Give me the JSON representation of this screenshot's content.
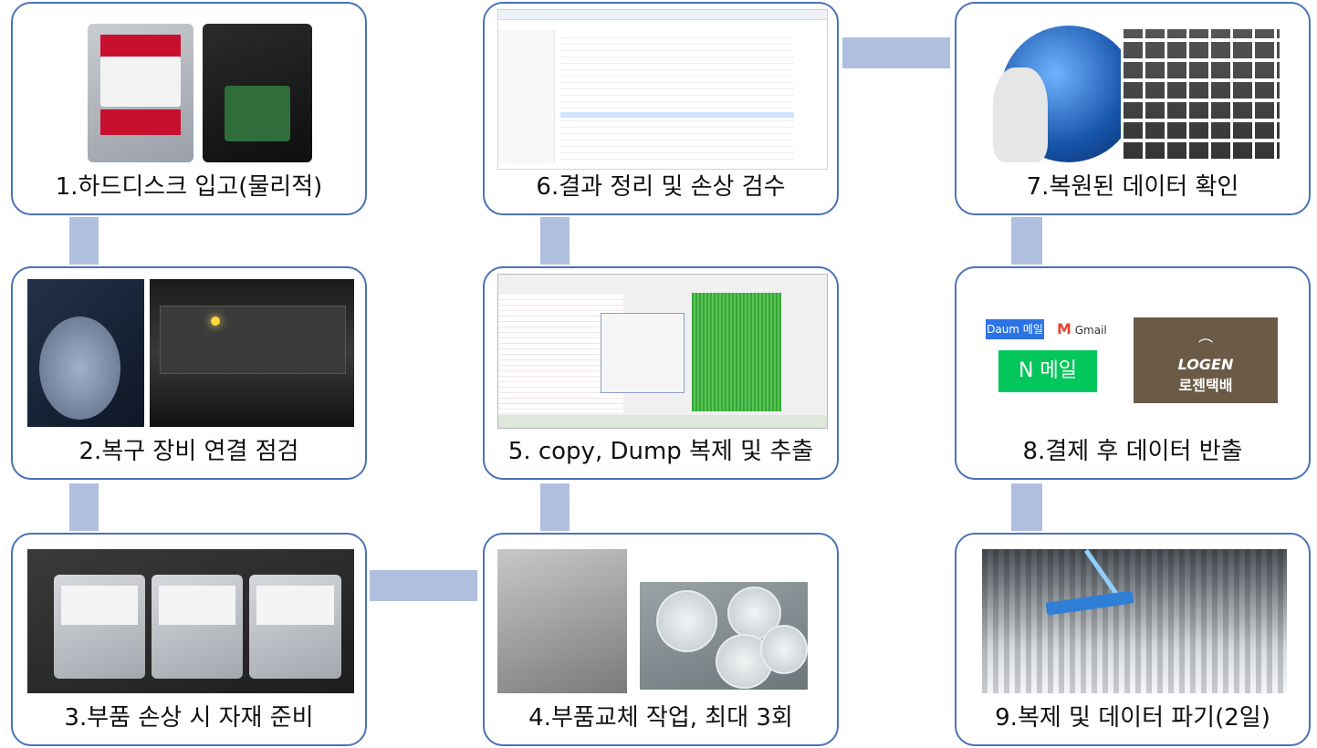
{
  "steps": [
    {
      "caption": "1.하드디스크 입고(물리적)"
    },
    {
      "caption": "2.복구 장비 연결 점검"
    },
    {
      "caption": "3.부품 손상 시 자재 준비"
    },
    {
      "caption": "4.부품교체 작업, 최대 3회"
    },
    {
      "caption": "5. copy, Dump 복제 및 추출"
    },
    {
      "caption": "6.결과 정리 및 손상 검수"
    },
    {
      "caption": "7.복원된 데이터 확인"
    },
    {
      "caption": "8.결제 후 데이터 반출"
    },
    {
      "caption": "9.복제 및 데이터 파기(2일)"
    }
  ],
  "logos": {
    "daum": "Daum 메일",
    "gmail": "Gmail",
    "naver": "N 메일",
    "logen": "LOGEN",
    "logen_ko": "로젠택배"
  },
  "colors": {
    "box_border": "#4a72b8",
    "connector": "#b0bfe0"
  }
}
